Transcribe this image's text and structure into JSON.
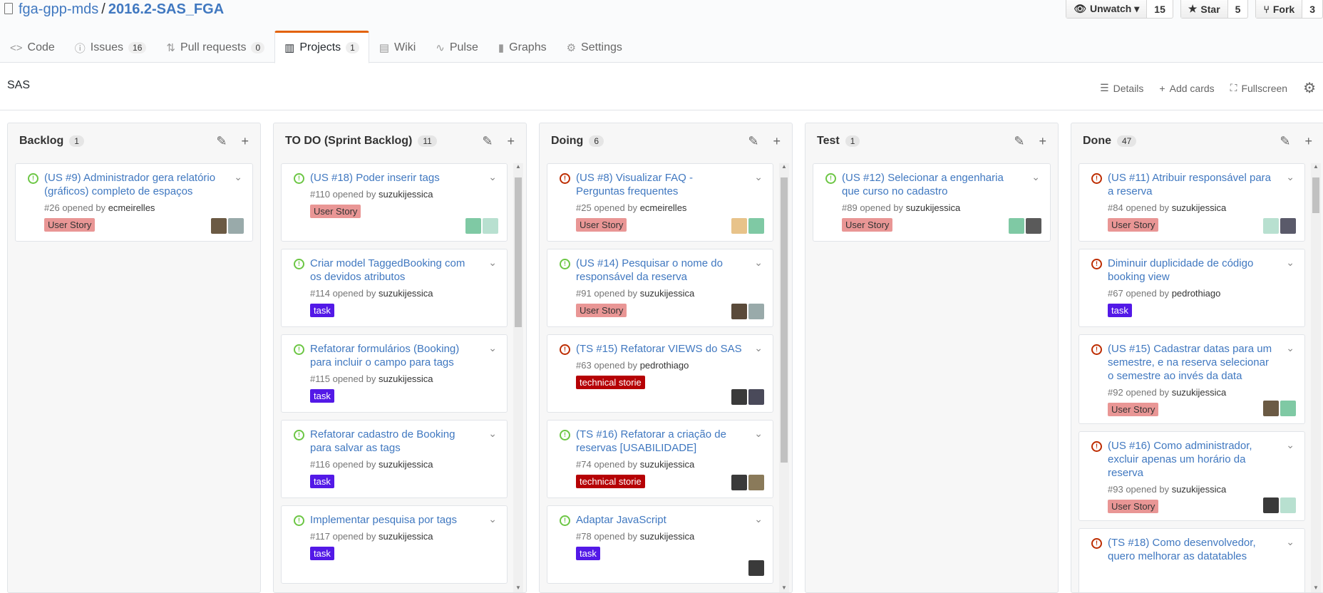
{
  "repo": {
    "owner": "fga-gpp-mds",
    "separator": "/",
    "name": "2016.2-SAS_FGA"
  },
  "actions": [
    {
      "label": "Unwatch ▾",
      "count": "15",
      "icon": "eye-icon"
    },
    {
      "label": "Star",
      "count": "5",
      "icon": "star-icon"
    },
    {
      "label": "Fork",
      "count": "3",
      "icon": "fork-icon"
    }
  ],
  "tabs": [
    {
      "label": "Code",
      "counter": "",
      "icon": "code-icon"
    },
    {
      "label": "Issues",
      "counter": "16",
      "icon": "issue-icon"
    },
    {
      "label": "Pull requests",
      "counter": "0",
      "icon": "pull-request-icon"
    },
    {
      "label": "Projects",
      "counter": "1",
      "icon": "project-icon",
      "active": true
    },
    {
      "label": "Wiki",
      "counter": "",
      "icon": "book-icon"
    },
    {
      "label": "Pulse",
      "counter": "",
      "icon": "pulse-icon"
    },
    {
      "label": "Graphs",
      "counter": "",
      "icon": "graph-icon"
    },
    {
      "label": "Settings",
      "counter": "",
      "icon": "gear-icon"
    }
  ],
  "project": {
    "name": "SAS",
    "tools": {
      "details": "Details",
      "add_cards": "Add cards",
      "fullscreen": "Fullscreen"
    }
  },
  "columns": [
    {
      "name": "Backlog",
      "count": "1",
      "cards": [
        {
          "title": "(US #9) Administrador gera relatório (gráficos) completo de espaços",
          "number": "#26",
          "user": "ecmeirelles",
          "label": "User Story",
          "label_type": "us",
          "closed": false
        }
      ]
    },
    {
      "name": "TO DO (Sprint Backlog)",
      "count": "11",
      "cards": [
        {
          "title": "(US #18) Poder inserir tags",
          "number": "#110",
          "user": "suzukijessica",
          "label": "User Story",
          "label_type": "us",
          "closed": false
        },
        {
          "title": "Criar model TaggedBooking com os devidos atributos",
          "number": "#114",
          "user": "suzukijessica",
          "label": "task",
          "label_type": "task",
          "closed": false
        },
        {
          "title": "Refatorar formulários (Booking) para incluir o campo para tags",
          "number": "#115",
          "user": "suzukijessica",
          "label": "task",
          "label_type": "task",
          "closed": false
        },
        {
          "title": "Refatorar cadastro de Booking para salvar as tags",
          "number": "#116",
          "user": "suzukijessica",
          "label": "task",
          "label_type": "task",
          "closed": false
        },
        {
          "title": "Implementar pesquisa por tags",
          "number": "#117",
          "user": "suzukijessica",
          "label": "task",
          "label_type": "task",
          "closed": false
        }
      ]
    },
    {
      "name": "Doing",
      "count": "6",
      "cards": [
        {
          "title": "(US #8) Visualizar FAQ - Perguntas frequentes",
          "number": "#25",
          "user": "ecmeirelles",
          "label": "User Story",
          "label_type": "us",
          "closed": true
        },
        {
          "title": "(US #14) Pesquisar o nome do responsável da reserva",
          "number": "#91",
          "user": "suzukijessica",
          "label": "User Story",
          "label_type": "us",
          "closed": false
        },
        {
          "title": "(TS #15) Refatorar VIEWS do SAS",
          "number": "#63",
          "user": "pedrothiago",
          "label": "technical storie",
          "label_type": "tech",
          "closed": true
        },
        {
          "title": "(TS #16) Refatorar a criação de reservas [USABILIDADE]",
          "number": "#74",
          "user": "suzukijessica",
          "label": "technical storie",
          "label_type": "tech",
          "closed": false
        },
        {
          "title": "Adaptar JavaScript",
          "number": "#78",
          "user": "suzukijessica",
          "label": "task",
          "label_type": "task",
          "closed": false
        }
      ]
    },
    {
      "name": "Test",
      "count": "1",
      "cards": [
        {
          "title": "(US #12) Selecionar a engenharia que curso no cadastro",
          "number": "#89",
          "user": "suzukijessica",
          "label": "User Story",
          "label_type": "us",
          "closed": false
        }
      ]
    },
    {
      "name": "Done",
      "count": "47",
      "cards": [
        {
          "title": "(US #11) Atribuir responsável para a reserva",
          "number": "#84",
          "user": "suzukijessica",
          "label": "User Story",
          "label_type": "us",
          "closed": true
        },
        {
          "title": "Diminuir duplicidade de código booking view",
          "number": "#67",
          "user": "pedrothiago",
          "label": "task",
          "label_type": "task",
          "closed": true
        },
        {
          "title": "(US #15) Cadastrar datas para um semestre, e na reserva selecionar o semestre ao invés da data",
          "number": "#92",
          "user": "suzukijessica",
          "label": "User Story",
          "label_type": "us",
          "closed": true
        },
        {
          "title": "(US #16) Como administrador, excluir apenas um horário da reserva",
          "number": "#93",
          "user": "suzukijessica",
          "label": "User Story",
          "label_type": "us",
          "closed": true
        },
        {
          "title": "(TS #18) Como desenvolvedor, quero melhorar as datatables",
          "number": "",
          "user": "",
          "label": "",
          "label_type": "",
          "closed": true
        }
      ]
    }
  ],
  "opened_by_text": "opened by",
  "colors": {
    "open": "#6cc644",
    "closed": "#bd2c00",
    "link": "#4078c0",
    "accent": "#e36209"
  }
}
